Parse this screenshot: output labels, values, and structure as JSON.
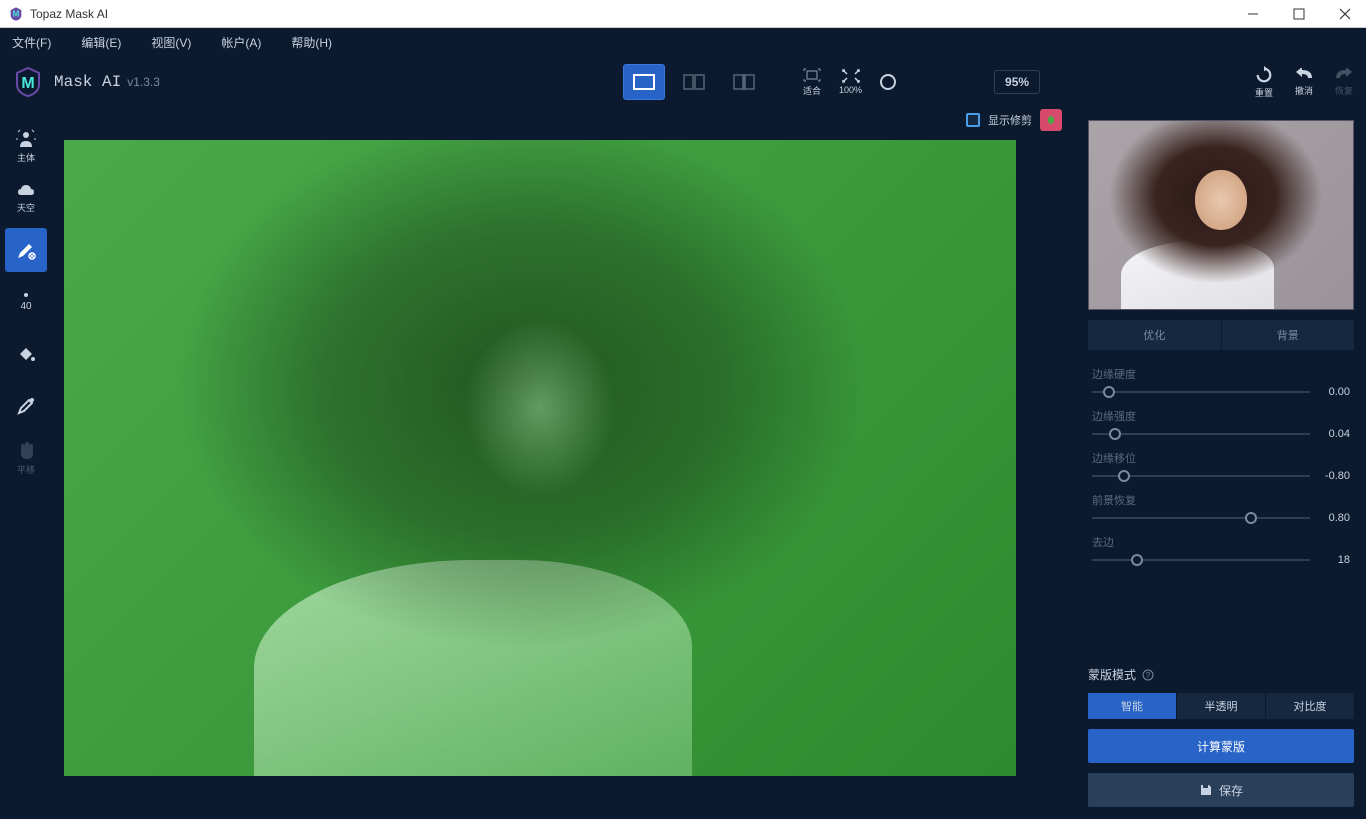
{
  "window": {
    "title": "Topaz Mask AI"
  },
  "menubar": {
    "file": "文件(F)",
    "edit": "编辑(E)",
    "view": "视图(V)",
    "account": "帐户(A)",
    "help": "帮助(H)"
  },
  "app": {
    "name": "Mask AI",
    "version": "v1.3.3"
  },
  "header": {
    "zoom_fit": "适合",
    "zoom_100": "100%",
    "zoom_value": "95%",
    "reset": "重置",
    "undo": "撤消",
    "redo": "恢复"
  },
  "canvas": {
    "show_trim": "显示修剪"
  },
  "left_tools": {
    "subject": "主体",
    "sky": "天空",
    "brush_size": "40",
    "hand": "平移"
  },
  "right": {
    "tabs": {
      "refine": "优化",
      "replace": "背景"
    },
    "sliders": [
      {
        "label": "边缘硬度",
        "value": "0.00",
        "pos": 5
      },
      {
        "label": "边缘强度",
        "value": "0.04",
        "pos": 8
      },
      {
        "label": "边缘移位",
        "value": "-0.80",
        "pos": 12
      },
      {
        "label": "前景恢复",
        "value": "0.80",
        "pos": 70
      },
      {
        "label": "去边",
        "value": "18",
        "pos": 18
      }
    ],
    "mask_mode_label": "蒙版模式",
    "modes": {
      "smart": "智能",
      "semi": "半透明",
      "contrast": "对比度"
    },
    "compute": "计算蒙版",
    "save": "保存"
  }
}
